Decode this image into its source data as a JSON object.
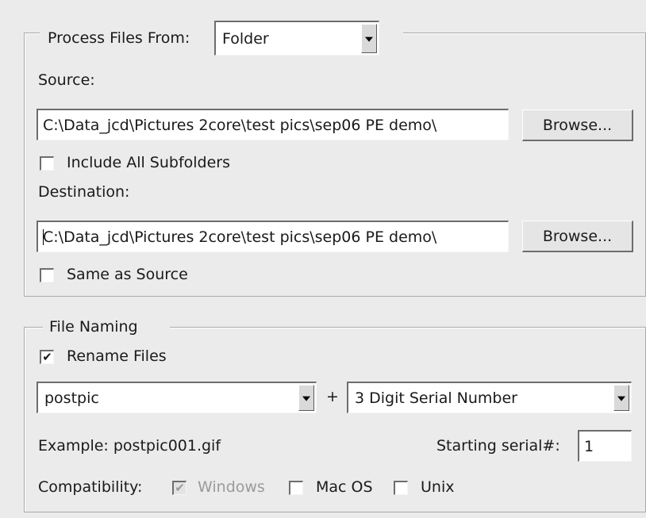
{
  "process": {
    "label": "Process Files From:",
    "source_type": "Folder",
    "source_label": "Source:",
    "source_path": "C:\\Data_jcd\\Pictures 2core\\test pics\\sep06 PE demo\\",
    "browse_label": "Browse...",
    "include_subfolders_label": "Include All Subfolders",
    "include_subfolders_checked": false,
    "destination_label": "Destination:",
    "destination_path": "C:\\Data_jcd\\Pictures 2core\\test pics\\sep06 PE demo\\",
    "same_as_source_label": "Same as Source",
    "same_as_source_checked": false
  },
  "naming": {
    "label": "File Naming",
    "rename_label": "Rename Files",
    "rename_checked": true,
    "check_mark": "✔",
    "name_part": "postpic",
    "plus": "+",
    "serial_type": "3 Digit Serial Number",
    "example_text": "Example: postpic001.gif",
    "starting_serial_label": "Starting serial#:",
    "starting_serial_value": "1",
    "compatibility_label": "Compatibility:",
    "windows_label": "Windows",
    "windows_checked": true,
    "windows_disabled": true,
    "macos_label": "Mac OS",
    "macos_checked": false,
    "unix_label": "Unix",
    "unix_checked": false
  }
}
